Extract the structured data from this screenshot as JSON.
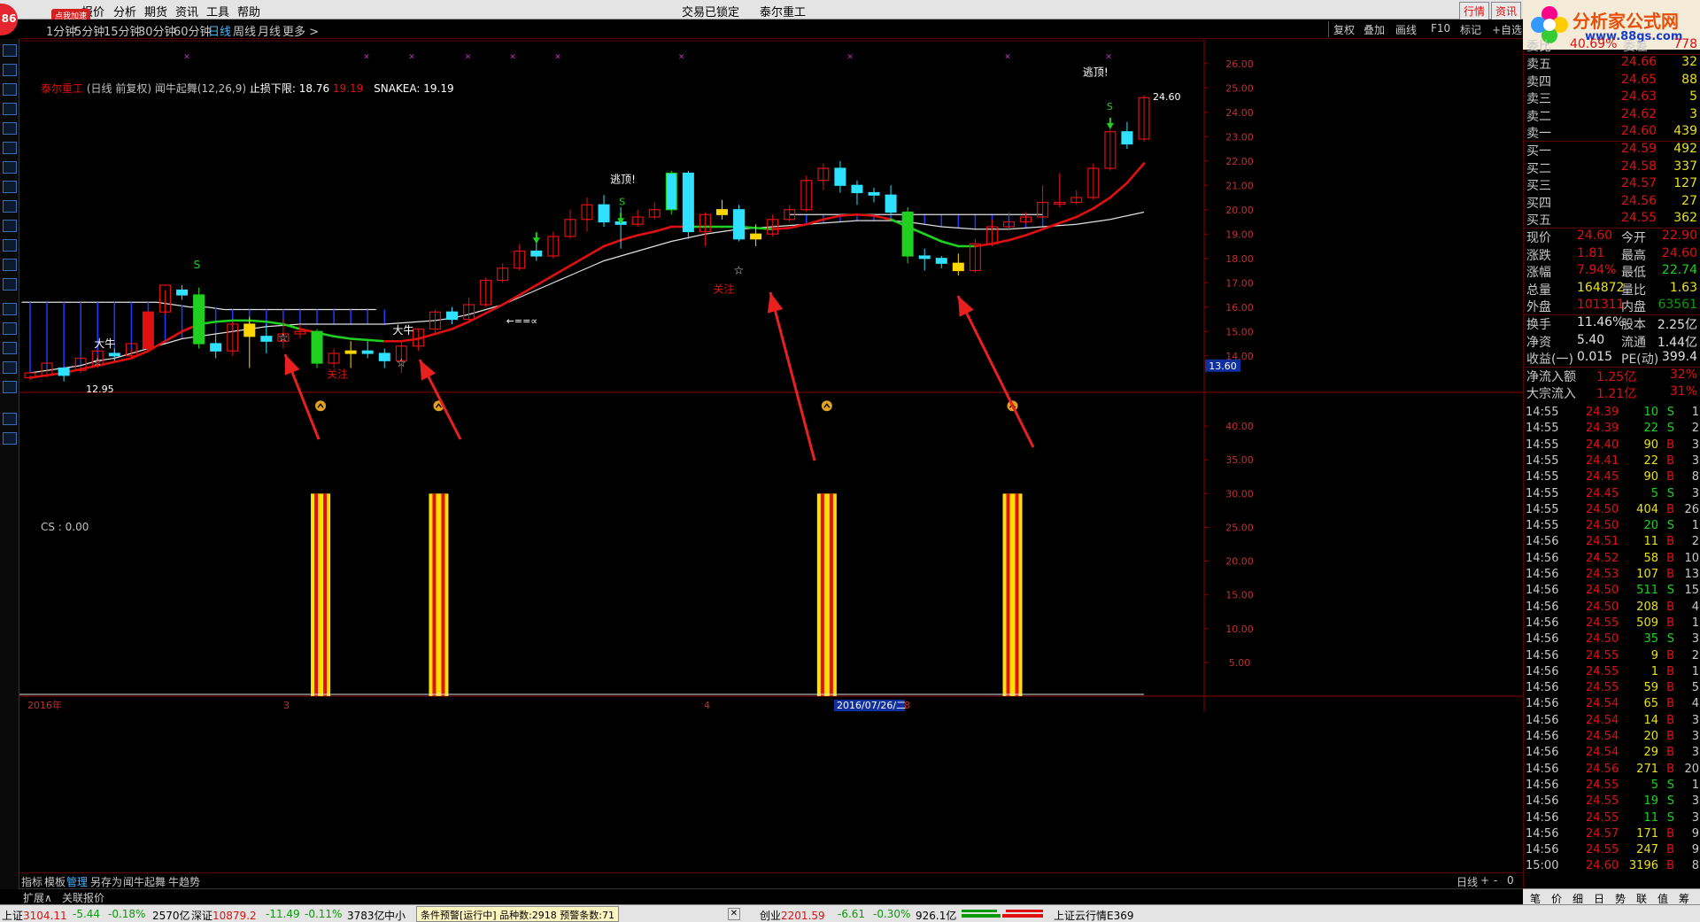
{
  "menu": {
    "items": [
      "行情",
      "报价",
      "分析",
      "期货",
      "资讯",
      "工具",
      "帮助"
    ],
    "center": "交易已锁定",
    "stock": "泰尔重工",
    "badge": "86",
    "speedup": "点我加速"
  },
  "period": {
    "items": [
      "1分钟",
      "5分钟",
      "15分钟",
      "30分钟",
      "60分钟",
      "日线",
      "周线",
      "月线",
      "更多 >"
    ],
    "active": "日线",
    "right": [
      "复权",
      "叠加",
      "画线",
      "F10",
      "标记",
      "+自选"
    ]
  },
  "header_tabs": [
    "行情",
    "资讯"
  ],
  "logo": {
    "title": "分析家公式网",
    "url": "www.88gs.com"
  },
  "info": {
    "stock": "泰尔重工",
    "mode": "(日线 前复权)",
    "indicator": "闻牛起舞(12,26,9)",
    "stop_label": "止损下限:",
    "stop_value": "18.76",
    "stop_value2": "19.19",
    "snake_label": "SNAKEA:",
    "snake_value": "19.19"
  },
  "cs_label": "CS : 0.00",
  "chart_data": {
    "type": "candlestick",
    "price_axis": {
      "min": 12.5,
      "max": 26.5,
      "ticks": [
        "26.00",
        "25.00",
        "24.00",
        "23.00",
        "22.00",
        "21.00",
        "20.00",
        "19.00",
        "18.00",
        "17.00",
        "16.00",
        "15.00",
        "14.00"
      ],
      "current_tag": "13.60"
    },
    "indicator_axis": {
      "min": 0,
      "max": 45,
      "ticks": [
        "40.00",
        "35.00",
        "30.00",
        "25.00",
        "20.00",
        "15.00",
        "10.00",
        "5.00"
      ]
    },
    "candles": [
      [
        13.1,
        13.3,
        13.0,
        13.2
      ],
      [
        13.2,
        13.7,
        13.1,
        13.5
      ],
      [
        13.5,
        13.2,
        12.95,
        13.4
      ],
      [
        13.4,
        13.9,
        13.3,
        13.6
      ],
      [
        13.6,
        14.2,
        13.5,
        14.1
      ],
      [
        14.1,
        14.0,
        13.8,
        14.3
      ],
      [
        14.0,
        14.5,
        13.9,
        14.3
      ],
      [
        14.3,
        15.8,
        14.2,
        15.8
      ],
      [
        15.8,
        16.9,
        15.7,
        16.7
      ],
      [
        16.7,
        16.5,
        16.3,
        16.9
      ],
      [
        16.5,
        14.5,
        14.3,
        16.8
      ],
      [
        14.5,
        14.2,
        13.9,
        14.9
      ],
      [
        14.2,
        15.3,
        14.0,
        15.4
      ],
      [
        15.3,
        14.8,
        13.5,
        15.6
      ],
      [
        14.8,
        14.6,
        14.1,
        15.3
      ],
      [
        14.6,
        14.9,
        14.3,
        15.5
      ],
      [
        14.9,
        15.0,
        14.7,
        15.3
      ],
      [
        15.0,
        13.7,
        13.5,
        15.1
      ],
      [
        13.7,
        14.1,
        13.5,
        14.3
      ],
      [
        14.1,
        14.2,
        13.5,
        14.6
      ],
      [
        14.2,
        14.1,
        13.9,
        14.6
      ],
      [
        14.1,
        13.8,
        13.5,
        14.3
      ],
      [
        13.8,
        14.4,
        13.3,
        14.6
      ],
      [
        14.4,
        15.1,
        14.2,
        15.1
      ],
      [
        15.1,
        15.8,
        14.9,
        15.9
      ],
      [
        15.8,
        15.5,
        15.3,
        16.0
      ],
      [
        15.5,
        16.1,
        15.4,
        16.4
      ],
      [
        16.1,
        17.1,
        16.0,
        17.2
      ],
      [
        17.1,
        17.6,
        17.0,
        17.8
      ],
      [
        17.6,
        18.3,
        17.5,
        18.6
      ],
      [
        18.3,
        18.1,
        17.9,
        18.7
      ],
      [
        18.1,
        18.9,
        18.0,
        19.1
      ],
      [
        18.9,
        19.6,
        18.8,
        20.0
      ],
      [
        19.6,
        20.2,
        19.1,
        20.5
      ],
      [
        20.2,
        19.5,
        19.3,
        20.6
      ],
      [
        19.5,
        19.4,
        18.4,
        20.1
      ],
      [
        19.4,
        19.7,
        19.3,
        20.0
      ],
      [
        19.7,
        20.0,
        19.6,
        20.3
      ],
      [
        20.0,
        21.5,
        19.8,
        21.6
      ],
      [
        21.5,
        19.1,
        18.8,
        21.6
      ],
      [
        19.1,
        19.8,
        18.5,
        19.9
      ],
      [
        19.8,
        20.0,
        19.6,
        20.4
      ],
      [
        20.0,
        18.8,
        18.7,
        20.2
      ],
      [
        18.8,
        19.0,
        18.5,
        19.4
      ],
      [
        19.0,
        19.6,
        18.9,
        19.8
      ],
      [
        19.6,
        20.0,
        19.5,
        20.2
      ],
      [
        20.0,
        21.2,
        19.9,
        21.4
      ],
      [
        21.2,
        21.7,
        20.8,
        21.9
      ],
      [
        21.7,
        21.0,
        20.7,
        22.0
      ],
      [
        21.0,
        20.7,
        20.2,
        21.2
      ],
      [
        20.7,
        20.6,
        20.3,
        20.9
      ],
      [
        20.6,
        19.9,
        19.8,
        21.0
      ],
      [
        19.9,
        18.1,
        17.8,
        20.1
      ],
      [
        18.1,
        18.0,
        17.5,
        18.4
      ],
      [
        18.0,
        17.8,
        17.6,
        18.1
      ],
      [
        17.8,
        17.5,
        17.3,
        18.2
      ],
      [
        17.5,
        18.6,
        17.4,
        18.8
      ],
      [
        18.6,
        19.3,
        18.5,
        19.6
      ],
      [
        19.3,
        19.5,
        19.2,
        19.9
      ],
      [
        19.5,
        19.7,
        19.4,
        19.9
      ],
      [
        19.7,
        20.3,
        19.6,
        21.0
      ],
      [
        20.3,
        20.3,
        20.1,
        21.5
      ],
      [
        20.3,
        20.5,
        20.2,
        20.8
      ],
      [
        20.5,
        21.7,
        20.4,
        21.9
      ],
      [
        21.7,
        23.2,
        21.6,
        23.3
      ],
      [
        23.2,
        22.7,
        22.5,
        23.6
      ],
      [
        22.9,
        24.6,
        22.8,
        24.7
      ]
    ],
    "candle_colors": {
      "up": "#e01010",
      "down": "#30e0ff",
      "green": "#20d020",
      "yellow": "#ffd700"
    },
    "ma_colors": {
      "fast": "#e01010",
      "fast_down": "#20d020",
      "slow": "#e0e0e0"
    },
    "annotations": [
      {
        "text": "大牛",
        "color": "#ffffff"
      },
      {
        "text": "S",
        "color": "#20d020"
      },
      {
        "text": "关注",
        "color": "#e01010"
      },
      {
        "text": "大牛",
        "color": "#ffffff"
      },
      {
        "text": "逃顶!",
        "color": "#ffffff"
      },
      {
        "text": "S",
        "color": "#20d020"
      },
      {
        "text": "关注",
        "color": "#e01010"
      },
      {
        "text": "逃顶!",
        "color": "#ffffff"
      },
      {
        "text": "S",
        "color": "#20d020"
      },
      {
        "text": "24.60",
        "color": "#ffffff"
      },
      {
        "text": "12.95",
        "color": "#ffffff"
      },
      {
        "text": "←==∝",
        "color": "#ffffff"
      }
    ],
    "signal_bars": [
      {
        "index": 17,
        "value": 30
      },
      {
        "index": 24,
        "value": 30
      },
      {
        "index": 47,
        "value": 30
      },
      {
        "index": 58,
        "value": 30
      }
    ],
    "x_labels": [
      "2016年",
      "3",
      "4",
      "2016/07/26/二",
      "8"
    ]
  },
  "bottom_tabs": {
    "items": [
      "指标",
      "模板",
      "管理",
      "另存为",
      "闻牛起舞",
      "牛趋势"
    ],
    "active": "管理",
    "row2": [
      "扩展∧",
      "关联报价"
    ],
    "right": "日线",
    "pm": [
      "+",
      "-",
      "0"
    ]
  },
  "quote": {
    "committee": {
      "label": "委比",
      "value": "40.69%",
      "label2": "委差",
      "value2": "778"
    },
    "asks": [
      {
        "l": "卖五",
        "p": "24.66",
        "v": "32"
      },
      {
        "l": "卖四",
        "p": "24.65",
        "v": "88"
      },
      {
        "l": "卖三",
        "p": "24.63",
        "v": "5"
      },
      {
        "l": "卖二",
        "p": "24.62",
        "v": "3"
      },
      {
        "l": "卖一",
        "p": "24.60",
        "v": "439"
      }
    ],
    "bids": [
      {
        "l": "买一",
        "p": "24.59",
        "v": "492"
      },
      {
        "l": "买二",
        "p": "24.58",
        "v": "337"
      },
      {
        "l": "买三",
        "p": "24.57",
        "v": "127"
      },
      {
        "l": "买四",
        "p": "24.56",
        "v": "27"
      },
      {
        "l": "买五",
        "p": "24.55",
        "v": "362"
      }
    ],
    "stats": [
      {
        "l": "现价",
        "v": "24.60",
        "l2": "今开",
        "v2": "22.90"
      },
      {
        "l": "涨跌",
        "v": "1.81",
        "l2": "最高",
        "v2": "24.60"
      },
      {
        "l": "涨幅",
        "v": "7.94%",
        "l2": "最低",
        "v2": "22.74"
      },
      {
        "l": "总量",
        "v": "164872",
        "l2": "量比",
        "v2": "1.63"
      },
      {
        "l": "外盘",
        "v": "101311",
        "l2": "内盘",
        "v2": "63561"
      },
      {
        "l": "换手",
        "v": "11.46%",
        "l2": "股本",
        "v2": "2.25亿"
      },
      {
        "l": "净资",
        "v": "5.40",
        "l2": "流通",
        "v2": "1.44亿"
      },
      {
        "l": "收益(一)",
        "v": "0.015",
        "l2": "PE(动)",
        "v2": "399.4"
      },
      {
        "l": "净流入额",
        "v": "1.25亿",
        "l2": "",
        "v2": "32%"
      },
      {
        "l": "大宗流入",
        "v": "1.21亿",
        "l2": "",
        "v2": "31%"
      }
    ],
    "ticks": [
      [
        "14:55",
        "24.39",
        "10",
        "S",
        "1"
      ],
      [
        "14:55",
        "24.39",
        "22",
        "S",
        "2"
      ],
      [
        "14:55",
        "24.40",
        "90",
        "B",
        "3"
      ],
      [
        "14:55",
        "24.41",
        "22",
        "B",
        "3"
      ],
      [
        "14:55",
        "24.45",
        "90",
        "B",
        "8"
      ],
      [
        "14:55",
        "24.45",
        "5",
        "S",
        "3"
      ],
      [
        "14:55",
        "24.50",
        "404",
        "B",
        "26"
      ],
      [
        "14:55",
        "24.50",
        "20",
        "S",
        "1"
      ],
      [
        "14:56",
        "24.51",
        "11",
        "B",
        "2"
      ],
      [
        "14:56",
        "24.52",
        "58",
        "B",
        "10"
      ],
      [
        "14:56",
        "24.53",
        "107",
        "B",
        "13"
      ],
      [
        "14:56",
        "24.50",
        "511",
        "S",
        "15"
      ],
      [
        "14:56",
        "24.50",
        "208",
        "B",
        "4"
      ],
      [
        "14:56",
        "24.55",
        "509",
        "B",
        "1"
      ],
      [
        "14:56",
        "24.50",
        "35",
        "S",
        "3"
      ],
      [
        "14:56",
        "24.55",
        "9",
        "B",
        "2"
      ],
      [
        "14:56",
        "24.55",
        "1",
        "B",
        "1"
      ],
      [
        "14:56",
        "24.55",
        "59",
        "B",
        "5"
      ],
      [
        "14:56",
        "24.54",
        "65",
        "B",
        "4"
      ],
      [
        "14:56",
        "24.54",
        "14",
        "B",
        "3"
      ],
      [
        "14:56",
        "24.54",
        "20",
        "B",
        "3"
      ],
      [
        "14:56",
        "24.54",
        "29",
        "B",
        "3"
      ],
      [
        "14:56",
        "24.56",
        "271",
        "B",
        "20"
      ],
      [
        "14:56",
        "24.55",
        "5",
        "S",
        "1"
      ],
      [
        "14:56",
        "24.55",
        "19",
        "S",
        "3"
      ],
      [
        "14:56",
        "24.55",
        "11",
        "S",
        "3"
      ],
      [
        "14:56",
        "24.57",
        "171",
        "B",
        "9"
      ],
      [
        "14:56",
        "24.55",
        "247",
        "B",
        "9"
      ],
      [
        "15:00",
        "24.60",
        "3196",
        "B",
        "8"
      ]
    ],
    "bottom": [
      "笔",
      "价",
      "细",
      "日",
      "势",
      "联",
      "值",
      "筹"
    ]
  },
  "status": {
    "sh": {
      "label": "上证",
      "v": "3104.11",
      "c": "-5.44",
      "p": "-0.18%",
      "a": "2570亿"
    },
    "sz": {
      "label": "深证",
      "v": "10879.2",
      "c": "-11.49",
      "p": "-0.11%",
      "a": "3783亿"
    },
    "zx": {
      "label": "中小"
    },
    "alert": "条件预警[运行中] 品种数:2918 预警条数:71",
    "cy": {
      "label": "创业",
      "v": "2201.59",
      "c": "-6.61",
      "p": "-0.30%",
      "a": "926.1亿"
    },
    "cloud": "上证云行情E369"
  }
}
